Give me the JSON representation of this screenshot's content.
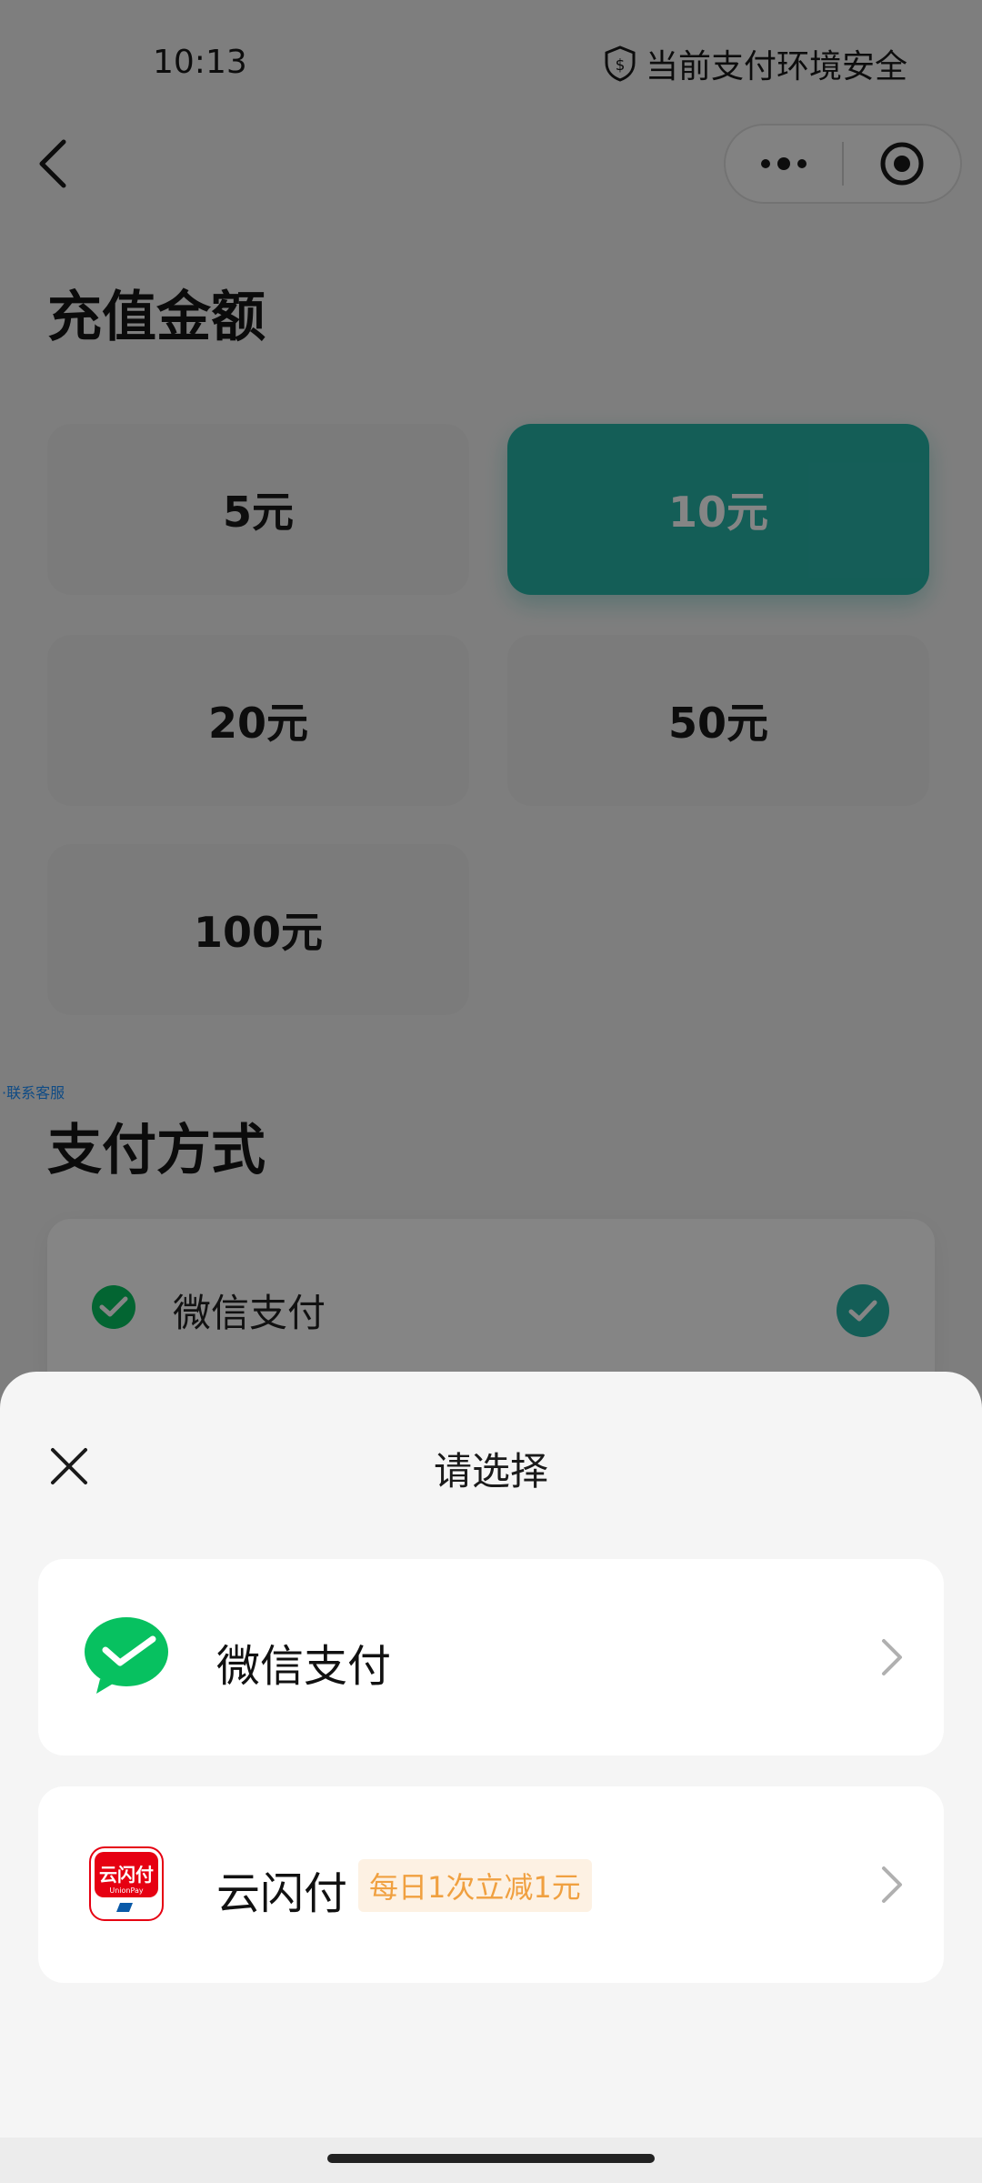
{
  "status_bar": {
    "time": "10:13",
    "security_text": "当前支付环境安全"
  },
  "recharge": {
    "title": "充值金额",
    "amounts": [
      {
        "label": "5元",
        "selected": false
      },
      {
        "label": "10元",
        "selected": true
      },
      {
        "label": "20元",
        "selected": false
      },
      {
        "label": "50元",
        "selected": false
      },
      {
        "label": "100元",
        "selected": false
      }
    ]
  },
  "tiny_link": "·联系客服",
  "payment": {
    "title": "支付方式",
    "current_method": "微信支付"
  },
  "sheet": {
    "title": "请选择",
    "options": [
      {
        "name": "微信支付",
        "icon": "wechat-pay-icon"
      },
      {
        "name": "云闪付",
        "promo": "每日1次立减1元",
        "icon": "unionpay-quickpass-icon",
        "logo_text": "云闪付",
        "logo_subtext": "UnionPay"
      }
    ]
  },
  "colors": {
    "accent": "#28b5a8",
    "wechat_green": "#07c160",
    "unionpay_red": "#e60012",
    "promo_text": "#f0a040"
  }
}
